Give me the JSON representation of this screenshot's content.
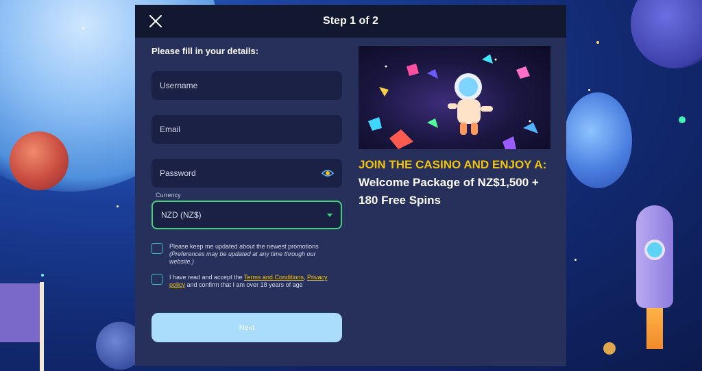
{
  "modal": {
    "title": "Step 1 of 2",
    "close_icon": "close-icon"
  },
  "form": {
    "heading": "Please fill in your details:",
    "username_placeholder": "Username",
    "email_placeholder": "Email",
    "password_placeholder": "Password",
    "password_toggle_icon": "eye-icon",
    "currency_label": "Currency",
    "currency_value": "NZD (NZ$)",
    "promo_checkbox": {
      "label": "Please keep me updated about the newest promotions",
      "note": "(Preferences may be updated at any time through our website.)"
    },
    "terms_checkbox": {
      "prefix": "I have read and accept the ",
      "terms_link": "Terms and Conditions",
      "separator": ", ",
      "privacy_link": "Privacy policy",
      "suffix": " and confirm that I am over 18 years of age"
    },
    "next_label": "Next"
  },
  "promo": {
    "image_icon": "astronaut-gems-illustration",
    "line1": "JOIN THE CASINO AND ENJOY A:",
    "line2": "Welcome Package of NZ$1,500 + 180 Free Spins"
  },
  "colors": {
    "modal_bg": "#272f5b",
    "header_bg": "#11182f",
    "accent_green": "#44d17a",
    "accent_yellow": "#f1c40f",
    "button_bg": "#a9ddfb"
  }
}
